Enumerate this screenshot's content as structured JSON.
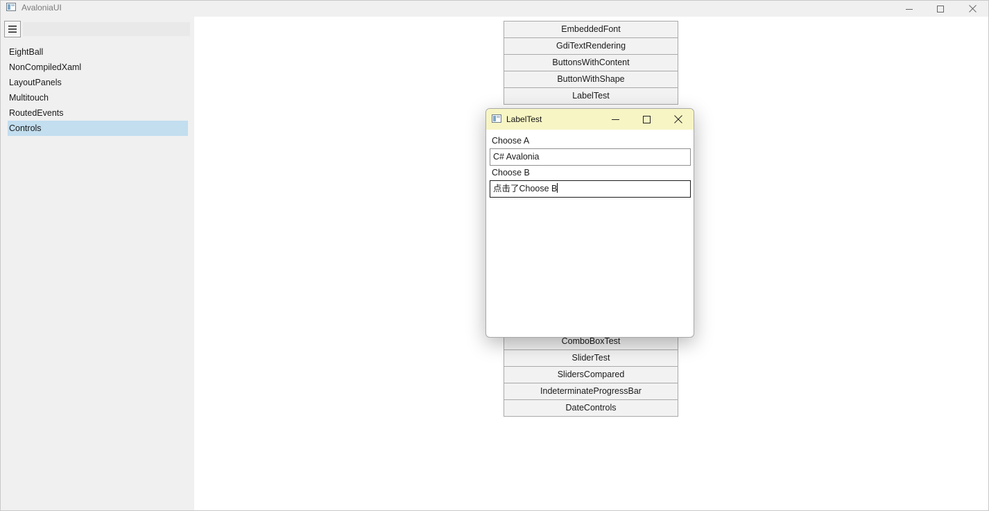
{
  "window": {
    "title": "AvaloniaUI",
    "controls": {
      "minimize": "minimize-icon",
      "maximize": "maximize-icon",
      "close": "close-icon"
    }
  },
  "sidebar": {
    "menu_icon": "hamburger-icon",
    "items": [
      {
        "label": "EightBall"
      },
      {
        "label": "NonCompiledXaml"
      },
      {
        "label": "LayoutPanels"
      },
      {
        "label": "Multitouch"
      },
      {
        "label": "RoutedEvents"
      },
      {
        "label": "Controls",
        "selected": true
      }
    ],
    "selected_color": "#c2deef"
  },
  "content": {
    "upper_buttons": [
      "EmbeddedFont",
      "GdiTextRendering",
      "ButtonsWithContent",
      "ButtonWithShape",
      "LabelTest"
    ],
    "lower_buttons": [
      "ComboBoxTest",
      "SliderTest",
      "SlidersCompared",
      "IndeterminateProgressBar",
      "DateControls"
    ]
  },
  "dialog": {
    "title": "LabelTest",
    "titlebar_color": "#f7f5c4",
    "label_a": "Choose A",
    "value_a": "C# Avalonia",
    "label_b": "Choose B",
    "value_b": "点击了Choose B"
  }
}
